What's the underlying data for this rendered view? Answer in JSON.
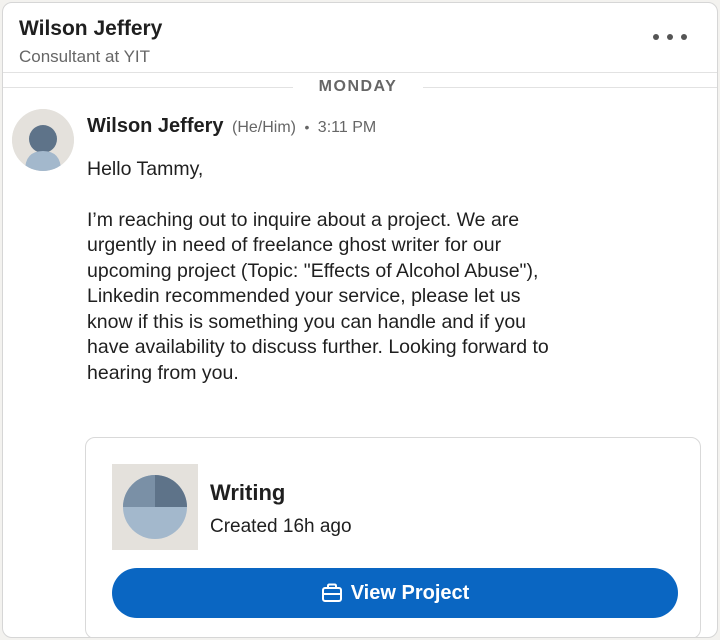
{
  "header": {
    "name": "Wilson Jeffery",
    "subtitle": "Consultant at YIT",
    "more_icon": "ellipsis-icon"
  },
  "divider": {
    "label": "MONDAY"
  },
  "message": {
    "sender": "Wilson Jeffery",
    "pronouns": "(He/Him)",
    "separator": "•",
    "time": "3:11 PM",
    "greeting": "Hello Tammy,",
    "body": "I’m reaching out to inquire about a project. We are\nurgently in need of freelance ghost writer for our\nupcoming project (Topic: \"Effects of Alcohol Abuse\"),\nLinkedin recommended your service, please let us\nknow if this is something you can handle and if you\nhave availability to discuss further. Looking forward to\nhearing from you."
  },
  "project_card": {
    "title": "Writing",
    "meta": "Created 16h ago",
    "button_label": "View Project",
    "button_icon": "briefcase-icon",
    "button_color": "#0a66c2"
  },
  "colors": {
    "avatar_bg": "#e4e1dc",
    "avatar_fg_dark": "#5e7389",
    "avatar_fg_light": "#a3b8cc"
  }
}
